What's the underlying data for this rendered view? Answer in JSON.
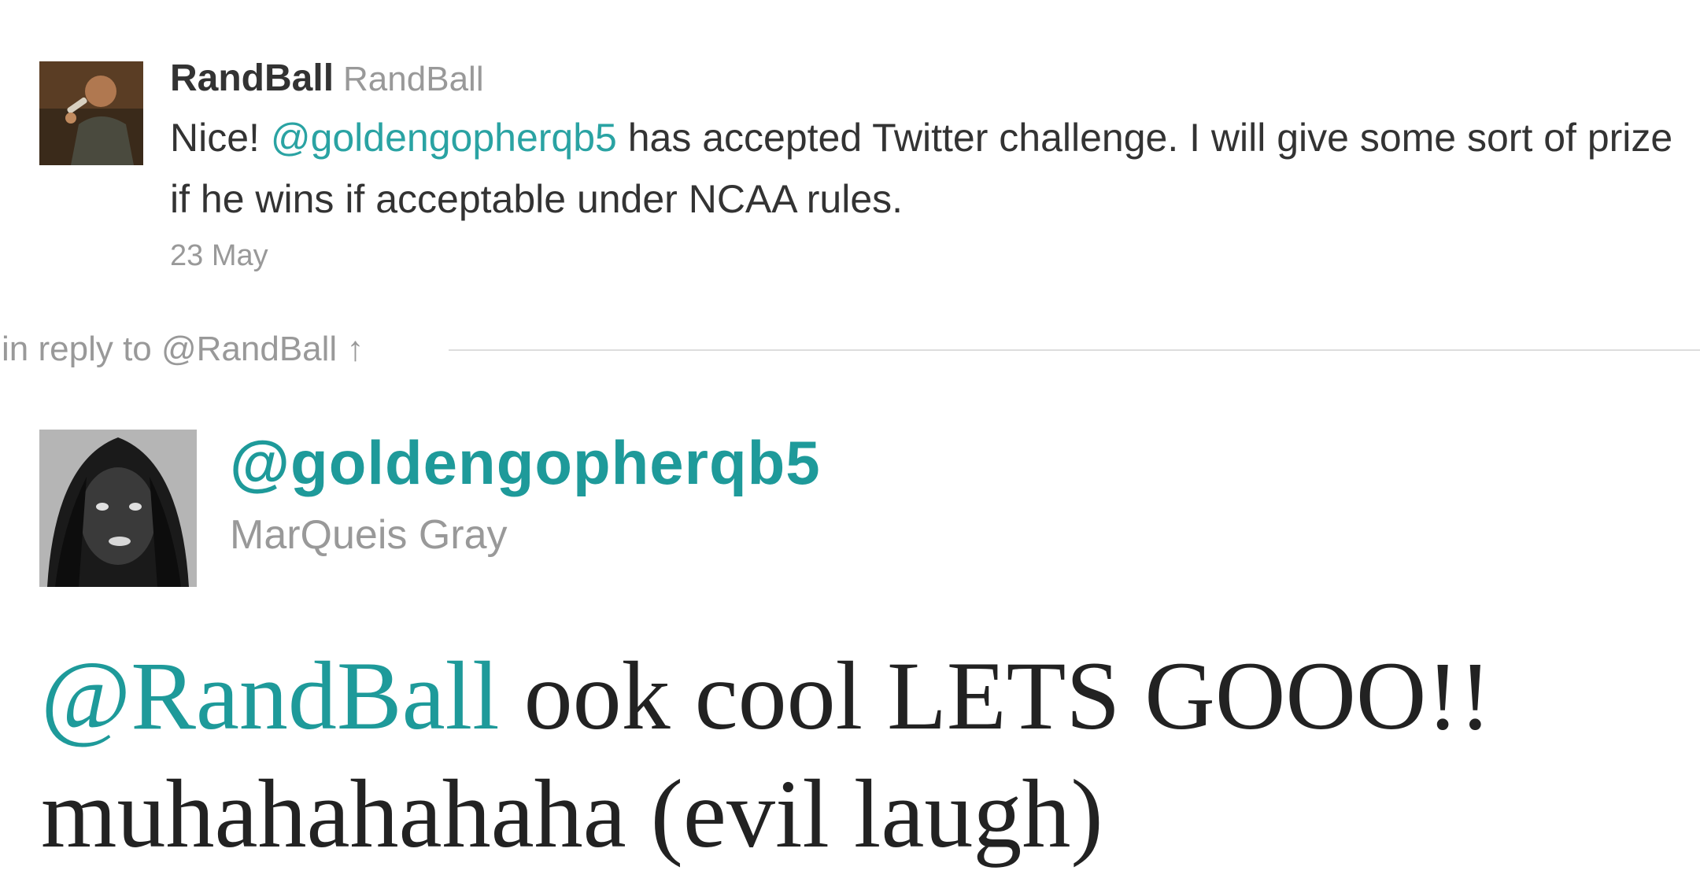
{
  "tweet1": {
    "screen_name": "RandBall",
    "full_name": "RandBall",
    "text_prefix": "Nice! ",
    "mention": "@goldengopherqb5",
    "text_suffix": " has accepted Twitter challenge. I will give some sort of prize if he wins if acceptable under NCAA rules.",
    "timestamp": "23 May"
  },
  "reply": {
    "label": "in reply to @RandBall",
    "arrow": "↑"
  },
  "tweet2": {
    "handle": "@goldengopherqb5",
    "full_name": "MarQueis Gray",
    "mention": "@RandBall",
    "text": " ook cool LETS GOOO!! muhahahahaha (evil laugh)"
  },
  "colors": {
    "mention": "#2aa3a3",
    "handle": "#1e9a9a",
    "muted": "#999999",
    "text": "#333333"
  }
}
